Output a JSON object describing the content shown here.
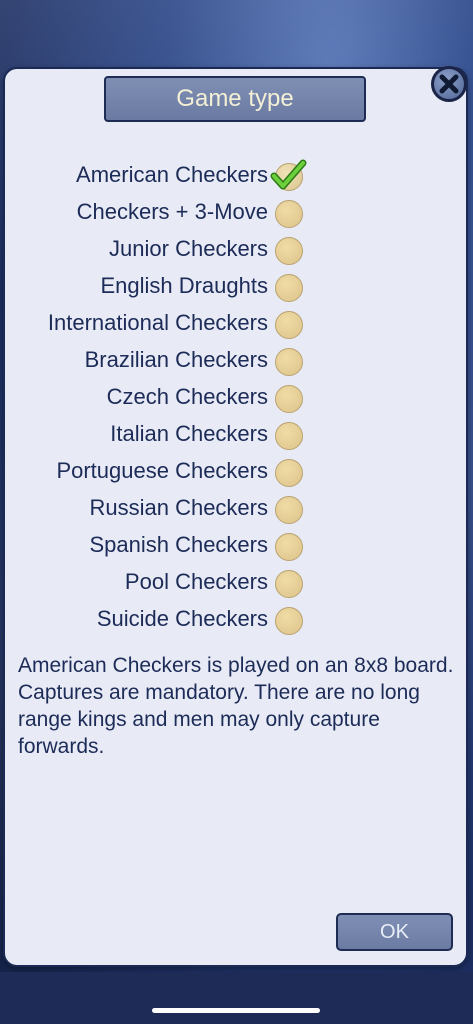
{
  "dialog": {
    "title": "Game type",
    "close_icon": "close-x-icon",
    "options": [
      {
        "label": "American Checkers",
        "selected": true
      },
      {
        "label": "Checkers + 3-Move",
        "selected": false
      },
      {
        "label": "Junior Checkers",
        "selected": false
      },
      {
        "label": "English Draughts",
        "selected": false
      },
      {
        "label": "International Checkers",
        "selected": false
      },
      {
        "label": "Brazilian Checkers",
        "selected": false
      },
      {
        "label": "Czech Checkers",
        "selected": false
      },
      {
        "label": "Italian Checkers",
        "selected": false
      },
      {
        "label": "Portuguese Checkers",
        "selected": false
      },
      {
        "label": "Russian Checkers",
        "selected": false
      },
      {
        "label": "Spanish Checkers",
        "selected": false
      },
      {
        "label": "Pool Checkers",
        "selected": false
      },
      {
        "label": "Suicide Checkers",
        "selected": false
      }
    ],
    "description": "American Checkers is played on an 8x8 board. Captures are mandatory. There are no long range kings and men may only capture forwards.",
    "ok_label": "OK"
  },
  "colors": {
    "dialog_bg": "#e8ebf5",
    "button_bg": "#7383ab",
    "text": "#1c2b57",
    "radio": "#dcc38a",
    "check": "#4caf2a"
  }
}
